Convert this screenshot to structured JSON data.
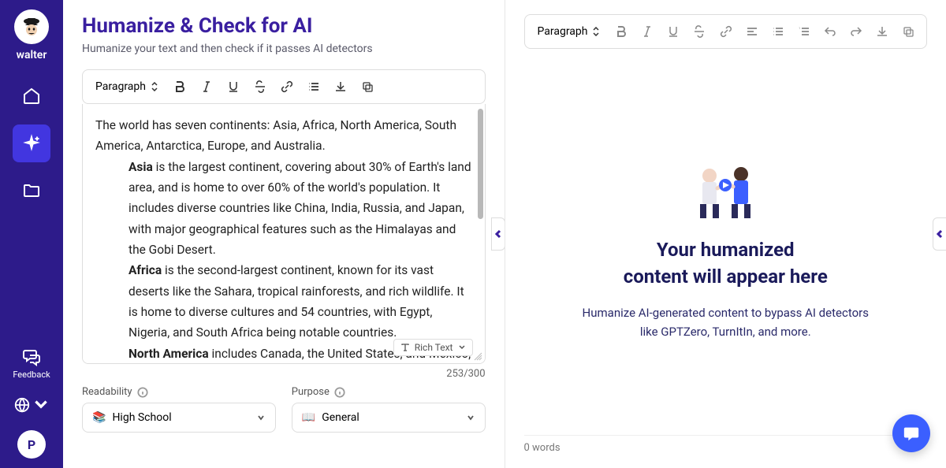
{
  "brand": "walter",
  "sidebar": {
    "feedback_label": "Feedback",
    "avatar_initial": "P"
  },
  "left": {
    "title": "Humanize & Check for AI",
    "subtitle": "Humanize your text and then check if it passes AI detectors",
    "toolbar": {
      "paragraph_label": "Paragraph"
    },
    "content": {
      "intro": "The world has seven continents: Asia, Africa, North America, South America, Antarctica, Europe, and Australia.",
      "asia_bold": "Asia",
      "asia_rest": " is the largest continent, covering about 30% of Earth's land area, and is home to over 60% of the world's population. It includes diverse countries like China, India, Russia, and Japan, with major geographical features such as the Himalayas and the Gobi Desert.",
      "africa_bold": "Africa",
      "africa_rest": " is the second-largest continent, known for its vast deserts like the Sahara, tropical rainforests, and rich wildlife. It is home to diverse cultures and 54 countries, with Egypt, Nigeria, and South Africa being notable countries.",
      "na_bold": "North America",
      "na_rest": " includes Canada, the United States, and Mexico, along with smaller countries in Central America"
    },
    "richtext_label": "Rich Text",
    "counter": "253/300",
    "readability": {
      "label": "Readability",
      "value": "High School"
    },
    "purpose": {
      "label": "Purpose",
      "value": "General"
    }
  },
  "right": {
    "toolbar": {
      "paragraph_label": "Paragraph"
    },
    "output_title_1": "Your humanized",
    "output_title_2": "content will appear here",
    "output_sub": "Humanize AI-generated content to bypass AI detectors like GPTZero, TurnItIn, and more.",
    "word_count": "0 words"
  }
}
